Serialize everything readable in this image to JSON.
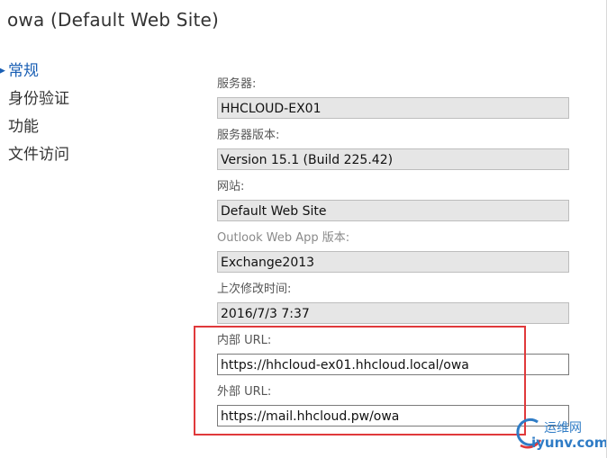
{
  "window": {
    "title": "owa (Default Web Site)"
  },
  "nav": {
    "items": [
      {
        "label": "常规"
      },
      {
        "label": "身份验证"
      },
      {
        "label": "功能"
      },
      {
        "label": "文件访问"
      }
    ]
  },
  "form": {
    "server_label": "服务器:",
    "server_value": "HHCLOUD-EX01",
    "server_version_label": "服务器版本:",
    "server_version_value": "Version 15.1 (Build 225.42)",
    "website_label": "网站:",
    "website_value": "Default Web Site",
    "owa_version_label": "Outlook Web App 版本:",
    "owa_version_value": "Exchange2013",
    "modified_label": "上次修改时间:",
    "modified_value": "2016/7/3 7:37",
    "internal_url_label": "内部 URL:",
    "internal_url_value": "https://hhcloud-ex01.hhcloud.local/owa",
    "external_url_label": "外部 URL:",
    "external_url_value": "https://mail.hhcloud.pw/owa"
  },
  "watermark": {
    "top": "运维网",
    "bottom": "iyunv.com"
  },
  "colors": {
    "accent": "#1a5fb4",
    "highlight_border": "#e0393b",
    "watermark": "#2f7cc6",
    "readonly_fill": "#e6e6e6"
  }
}
